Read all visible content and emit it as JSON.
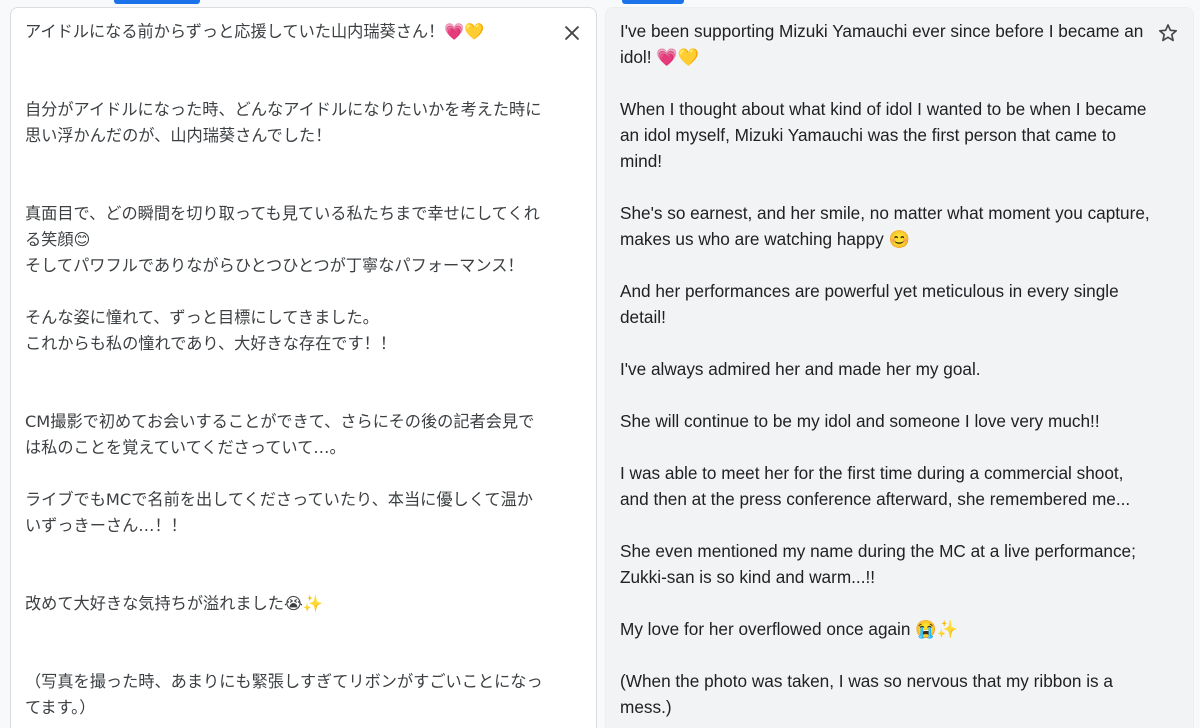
{
  "source": {
    "paragraphs": [
      "アイドルになる前からずっと応援していた山内瑞葵さん！💗💛",
      "",
      "",
      "自分がアイドルになった時、どんなアイドルになりたいかを考えた時に思い浮かんだのが、山内瑞葵さんでした！",
      "",
      "",
      "真面目で、どの瞬間を切り取っても見ている私たちまで幸せにしてくれる笑顔😊\nそしてパワフルでありながらひとつひとつが丁寧なパフォーマンス！",
      "",
      "そんな姿に憧れて、ずっと目標にしてきました。\nこれからも私の憧れであり、大好きな存在です！！",
      "",
      "",
      "CM撮影で初めてお会いすることができて、さらにその後の記者会見では私のことを覚えていてくださっていて…。",
      "",
      "ライブでもMCで名前を出してくださっていたり、本当に優しくて温かいずっきーさん…！！",
      "",
      "",
      "改めて大好きな気持ちが溢れました😭✨",
      "",
      "",
      "（写真を撮った時、あまりにも緊張しすぎてリボンがすごいことになってます。）"
    ]
  },
  "target": {
    "paragraphs": [
      "I've been supporting Mizuki Yamauchi ever since before I became an idol! 💗💛",
      "",
      "When I thought about what kind of idol I wanted to be when I became an idol myself, Mizuki Yamauchi was the first person that came to mind!",
      "",
      "She's so earnest, and her smile, no matter what moment you capture, makes us who are watching happy 😊",
      "",
      "And her performances are powerful yet meticulous in every single detail!",
      "",
      "I've always admired her and made her my goal.",
      "",
      "She will continue to be my idol and someone I love very much!!",
      "",
      "I was able to meet her for the first time during a commercial shoot, and then at the press conference afterward, she remembered me...",
      "",
      "She even mentioned my name during the MC at a live performance; Zukki-san is so kind and warm...!!",
      "",
      "My love for her overflowed once again 😭✨",
      "",
      "(When the photo was taken, I was so nervous that my ribbon is a mess.)"
    ]
  },
  "icons": {
    "clear": "close-icon",
    "save": "star-outline-icon"
  },
  "colors": {
    "accent": "#1a73e8",
    "text": "#3c4043",
    "icon": "#444746"
  }
}
